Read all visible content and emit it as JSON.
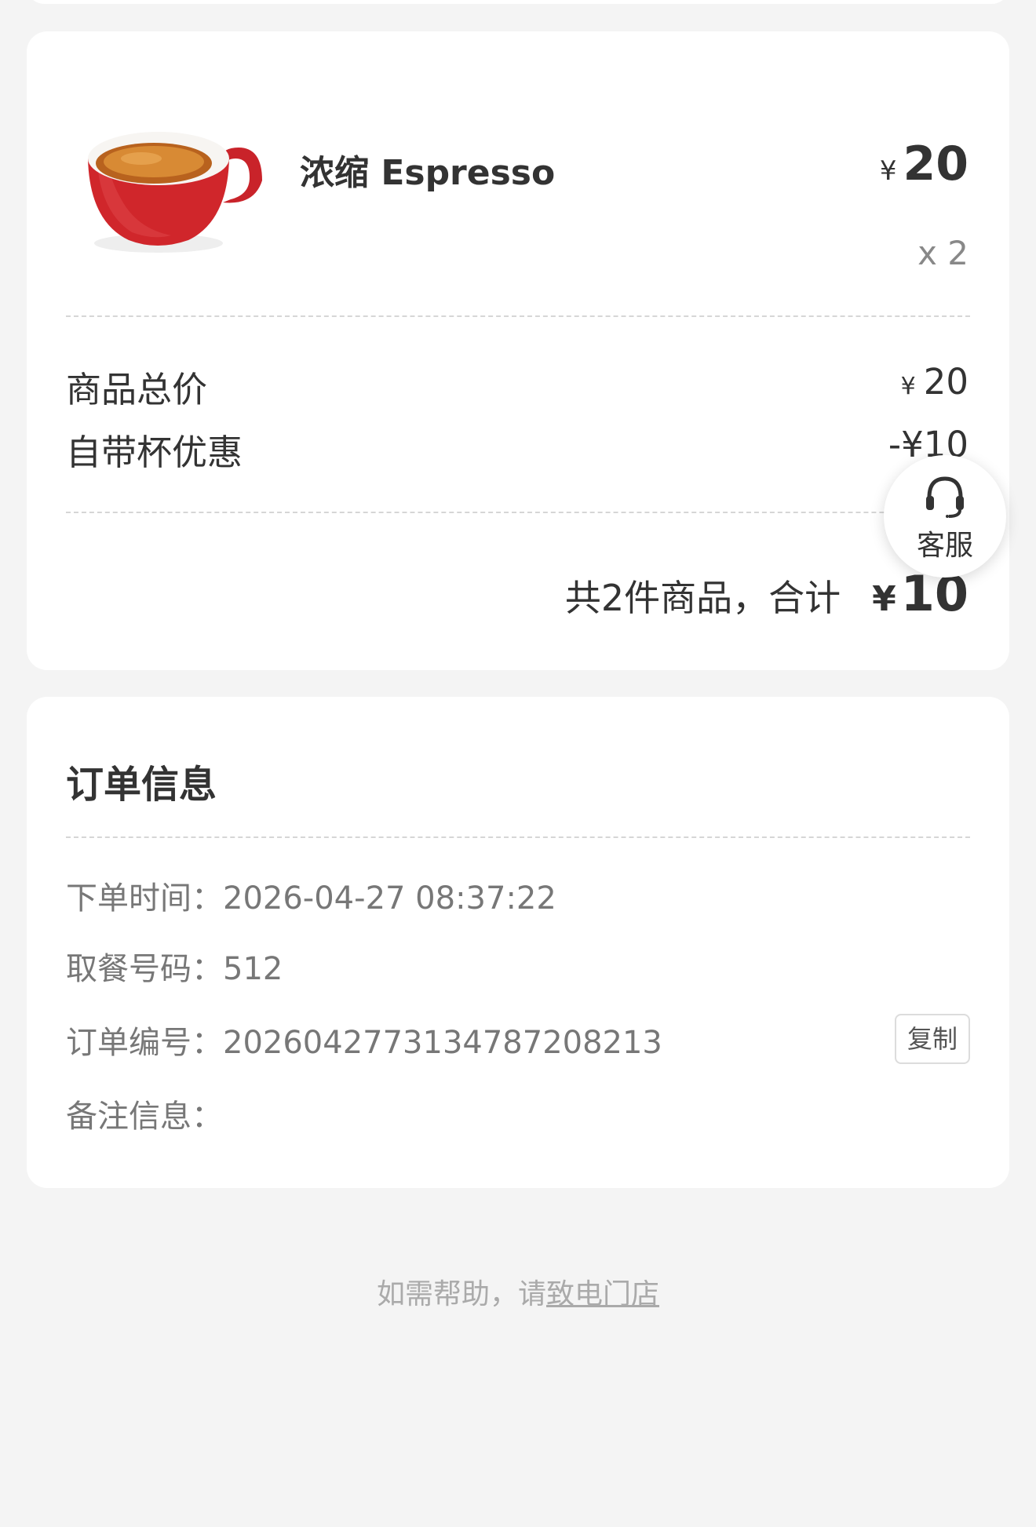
{
  "product": {
    "name": "浓缩 Espresso",
    "currency": "¥",
    "price": "20",
    "quantity": "x 2"
  },
  "summary": {
    "subtotal_label": "商品总价",
    "subtotal_currency": "¥",
    "subtotal_value": "20",
    "discount_label": "自带杯优惠",
    "discount_value": "-¥10",
    "total_text": "共2件商品，合计",
    "total_currency": "¥",
    "total_value": "10"
  },
  "customer_service": {
    "label": "客服",
    "icon": "headset-icon"
  },
  "order_info": {
    "title": "订单信息",
    "order_time_label": "下单时间：",
    "order_time_value": "2026-04-27 08:37:22",
    "pickup_label": "取餐号码：",
    "pickup_value": "512",
    "order_no_label": "订单编号：",
    "order_no_value": "2026042773134787208213",
    "copy_label": "复制",
    "remark_label": "备注信息："
  },
  "footer": {
    "help_prefix": "如需帮助，请",
    "help_link": "致电门店"
  },
  "colors": {
    "background": "#f4f4f4",
    "card": "#ffffff",
    "cup_red": "#d0262b"
  }
}
